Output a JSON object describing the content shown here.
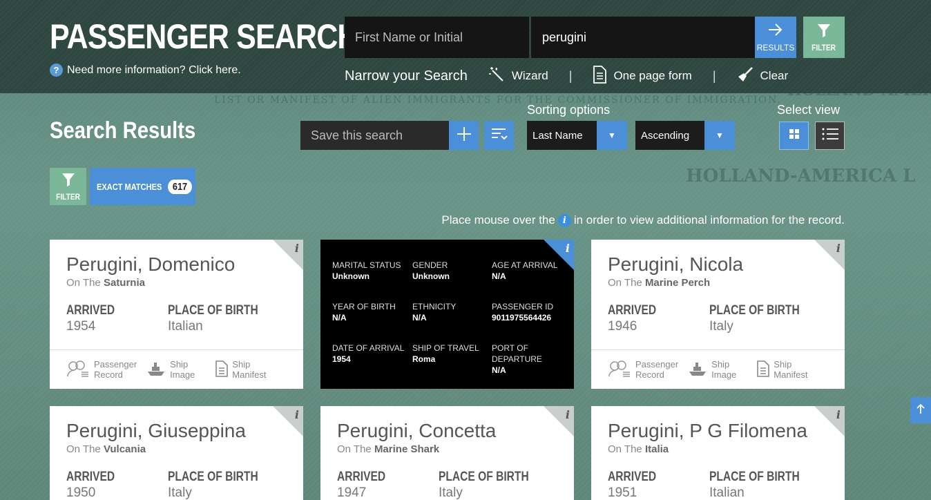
{
  "header": {
    "title": "PASSENGER SEARCH",
    "help": "Need more information? Click here.",
    "first_name_placeholder": "First Name or Initial",
    "last_name_value": "perugini",
    "results_label": "RESULTS",
    "filter_label": "FILTER",
    "narrow_label": "Narrow your Search",
    "wizard_label": "Wizard",
    "one_page_label": "One page form",
    "clear_label": "Clear",
    "separator": "|"
  },
  "toolbar": {
    "results_title": "Search Results",
    "save_placeholder": "Save this search",
    "sorting_label": "Sorting options",
    "sort_field": "Last Name",
    "sort_order": "Ascending",
    "view_label": "Select view",
    "filter_label": "FILTER",
    "exact_label": "EXACT MATCHES",
    "exact_count": "617",
    "hint_before": "Place mouse over the",
    "hint_after": "in order to view additional information for the record."
  },
  "labels": {
    "on_the": "On The",
    "arrived": "ARRIVED",
    "place_of_birth": "PLACE OF BIRTH",
    "passenger_record": [
      "Passenger",
      "Record"
    ],
    "ship_image": [
      "Ship",
      "Image"
    ],
    "ship_manifest": [
      "Ship",
      "Manifest"
    ],
    "info_i": "i"
  },
  "cards": [
    {
      "name": "Perugini, Domenico",
      "ship": "Saturnia",
      "arrived": "1954",
      "birth": "Italian"
    },
    {
      "name": "Perugini, Nicola",
      "ship": "Marine Perch",
      "arrived": "1946",
      "birth": "Italy"
    },
    {
      "name": "Perugini, Giuseppina",
      "ship": "Vulcania",
      "arrived": "1950",
      "birth": "Italy"
    },
    {
      "name": "Perugini, Concetta",
      "ship": "Marine Shark",
      "arrived": "1947",
      "birth": "Italy"
    },
    {
      "name": "Perugini, P G Filomena",
      "ship": "Italia",
      "arrived": "1951",
      "birth": "Italian"
    }
  ],
  "detail": {
    "marital_status_label": "MARITAL STATUS",
    "marital_status": "Unknown",
    "gender_label": "GENDER",
    "gender": "Unknown",
    "age_label": "AGE AT ARRIVAL",
    "age": "N/A",
    "yob_label": "YEAR OF BIRTH",
    "yob": "N/A",
    "ethnicity_label": "ETHNICITY",
    "ethnicity": "N/A",
    "pid_label": "PASSENGER ID",
    "pid": "9011975564426",
    "doa_label": "DATE OF ARRIVAL",
    "doa": "1954",
    "ship_label": "SHIP OF TRAVEL",
    "ship": "Roma",
    "port_label_1": "PORT OF",
    "port_label_2": "DEPARTURE",
    "port": "N/A"
  },
  "background_text": {
    "manifest": "LIST OR MANIFEST OF ALIEN IMMIGRANTS FOR THE COMMISSIONER OF IMMIGRATION.",
    "holland_1": "HOLLAND-AMERIC",
    "holland_2": "HOLLAND-AMERICA L"
  },
  "colors": {
    "accent": "#4a8fd8",
    "filter": "#7bb89a",
    "header": "#2e4640"
  }
}
